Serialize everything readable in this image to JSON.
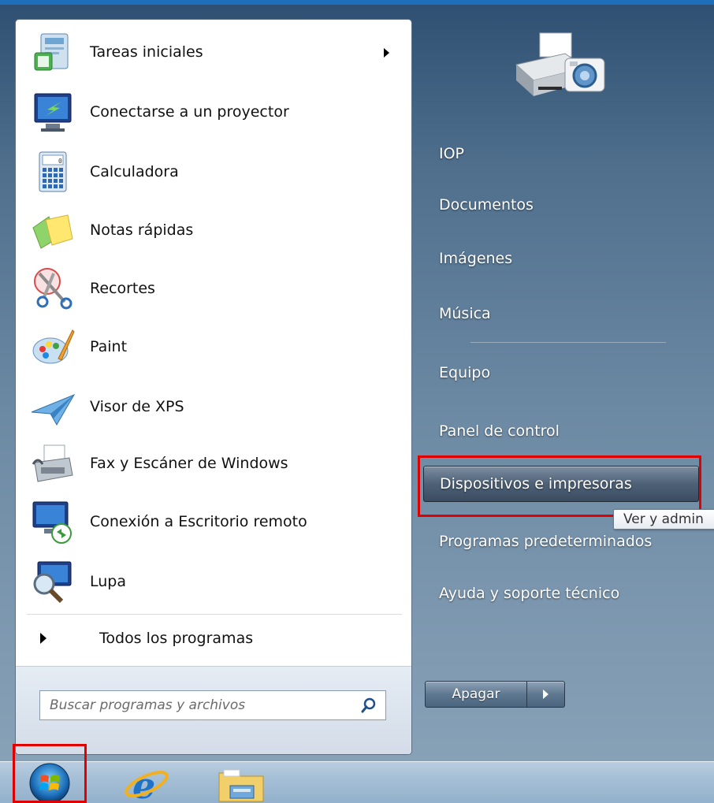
{
  "programs": [
    {
      "label": "Tareas iniciales",
      "icon": "getting-started-icon",
      "submenu": true
    },
    {
      "label": "Conectarse a un proyector",
      "icon": "projector-icon",
      "submenu": false
    },
    {
      "label": "Calculadora",
      "icon": "calculator-icon",
      "submenu": false
    },
    {
      "label": "Notas rápidas",
      "icon": "sticky-notes-icon",
      "submenu": false
    },
    {
      "label": "Recortes",
      "icon": "snipping-tool-icon",
      "submenu": false
    },
    {
      "label": "Paint",
      "icon": "paint-icon",
      "submenu": false
    },
    {
      "label": "Visor de XPS",
      "icon": "xps-viewer-icon",
      "submenu": false
    },
    {
      "label": "Fax y Escáner de Windows",
      "icon": "fax-scanner-icon",
      "submenu": false
    },
    {
      "label": "Conexión a Escritorio remoto",
      "icon": "remote-desktop-icon",
      "submenu": false
    },
    {
      "label": "Lupa",
      "icon": "magnifier-icon",
      "submenu": false
    }
  ],
  "all_programs": "Todos los programas",
  "search": {
    "placeholder": "Buscar programas y archivos"
  },
  "places": [
    {
      "label": "IOP"
    },
    {
      "label": "Documentos"
    },
    {
      "label": "Imágenes"
    },
    {
      "label": "Música"
    },
    {
      "label": "Equipo"
    },
    {
      "label": "Panel de control"
    },
    {
      "label": "Dispositivos e impresoras",
      "highlighted": true
    },
    {
      "label": "Programas predeterminados"
    },
    {
      "label": "Ayuda y soporte técnico"
    }
  ],
  "tooltip": "Ver y admin",
  "shutdown": {
    "label": "Apagar"
  },
  "taskbar": {
    "items": [
      "start-orb-icon",
      "internet-explorer-icon",
      "windows-explorer-icon"
    ]
  },
  "colors": {
    "highlight_box": "#e00000",
    "accent": "#1d6fb9"
  }
}
